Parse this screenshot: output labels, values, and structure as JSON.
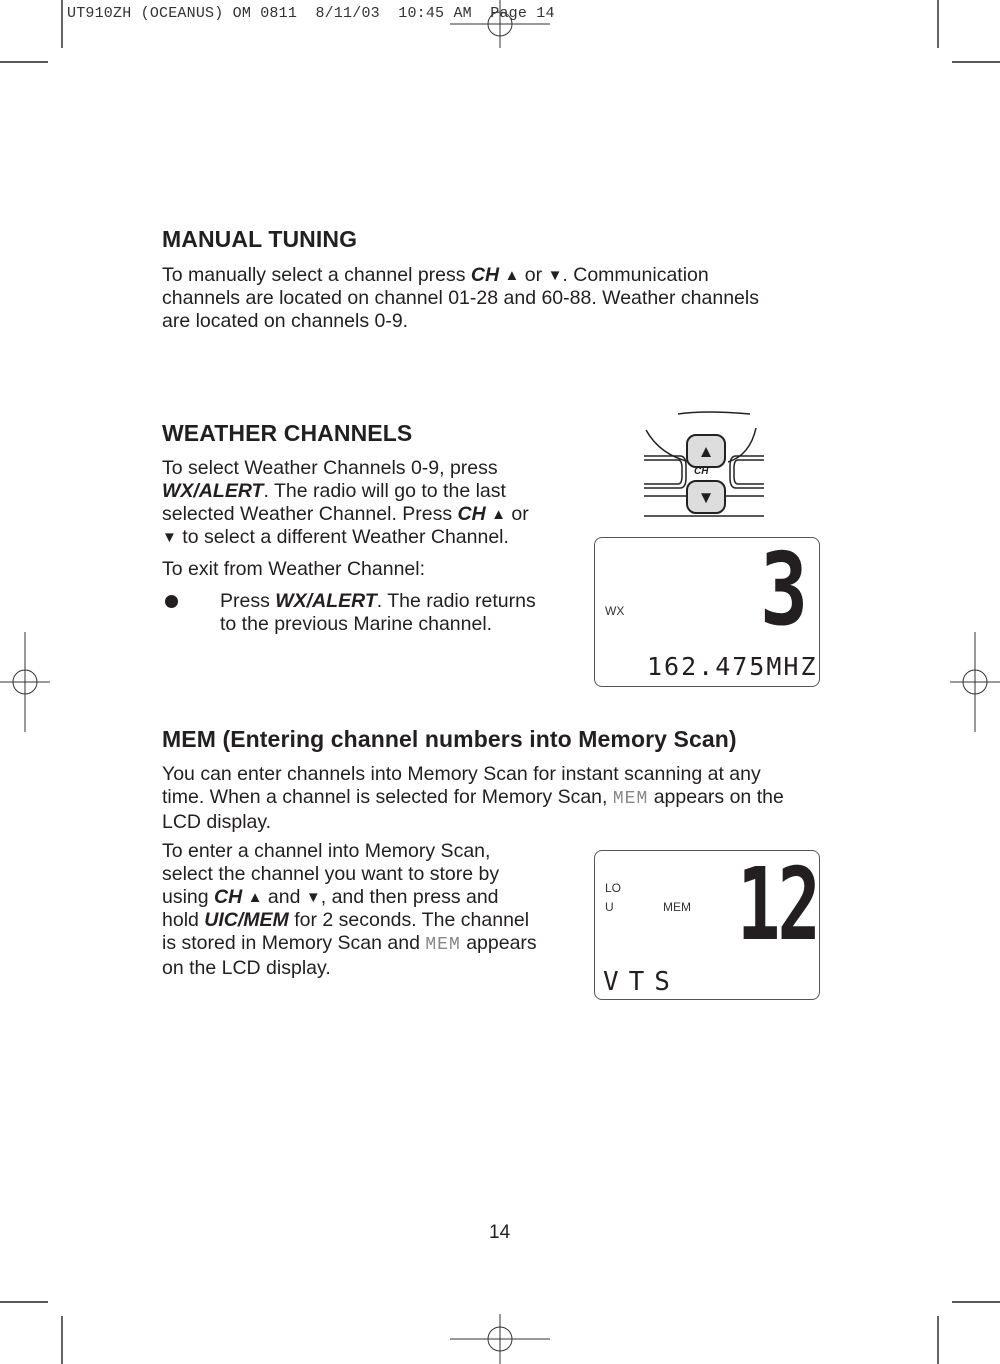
{
  "print_slug": "UT910ZH (OCEANUS) OM 0811  8/11/03  10:45 AM  Page 14",
  "sections": {
    "manual_tuning": {
      "heading": "MANUAL TUNING",
      "p1_a": "To manually select a channel press ",
      "p1_ch": "CH",
      "up": "▲",
      "p1_b": " or ",
      "down": "▼",
      "p1_c": ".  Communication",
      "line2": "channels are located on channel 01-28 and 60-88.  Weather channels",
      "line3": "are located on channels 0-9."
    },
    "weather_channels": {
      "heading": "WEATHER CHANNELS",
      "line1": "To select Weather Channels 0-9, press",
      "line2_key": "WX/ALERT",
      "line2_rest": ".  The radio will go to the last",
      "line3_a": "selected Weather Channel.  Press ",
      "line3_ch": "CH",
      "up": "▲",
      "line3_b": " or",
      "down": "▼",
      "line4": " to select a different Weather Channel.",
      "exit_intro": "To exit from Weather Channel:",
      "bullet_a": "Press ",
      "bullet_key": "WX/ALERT",
      "bullet_b": ".  The radio returns",
      "bullet_line2": "to the previous Marine channel."
    },
    "mem": {
      "heading": "MEM (Entering channel numbers into Memory Scan)",
      "p1_line1": "You can enter channels into Memory Scan for instant scanning at any",
      "p1_line2_a": "time. When a channel is selected for Memory Scan, ",
      "mem_lcd": "MEM",
      "p1_line2_b": " appears on the",
      "p1_line3": "LCD display.",
      "p2_line1": "To enter a channel into Memory Scan,",
      "p2_line2": "select the channel you want to store by",
      "p2_line3_a": "using ",
      "p2_ch": "CH",
      "up": "▲",
      "p2_line3_b": " and ",
      "down": "▼",
      "p2_line3_c": ", and then press and",
      "p2_line4_a": "hold ",
      "p2_key": "UIC/MEM",
      "p2_line4_b": " for 2 seconds.  The channel",
      "p2_line5_a": "is stored in Memory Scan and ",
      "p2_line5_b": " appears",
      "p2_line6": "on the LCD display."
    }
  },
  "illustrations": {
    "ch_buttons": {
      "label": "CH",
      "up_icon": "▲",
      "down_icon": "▼"
    },
    "lcd_weather": {
      "mode_label": "WX",
      "channel": "3",
      "frequency": "162.475MHZ"
    },
    "lcd_mem": {
      "power_label": "LO",
      "region_label": "U",
      "mem_label": "MEM",
      "channel": "12",
      "bottom_text": "VTS"
    }
  },
  "page_number": "14"
}
